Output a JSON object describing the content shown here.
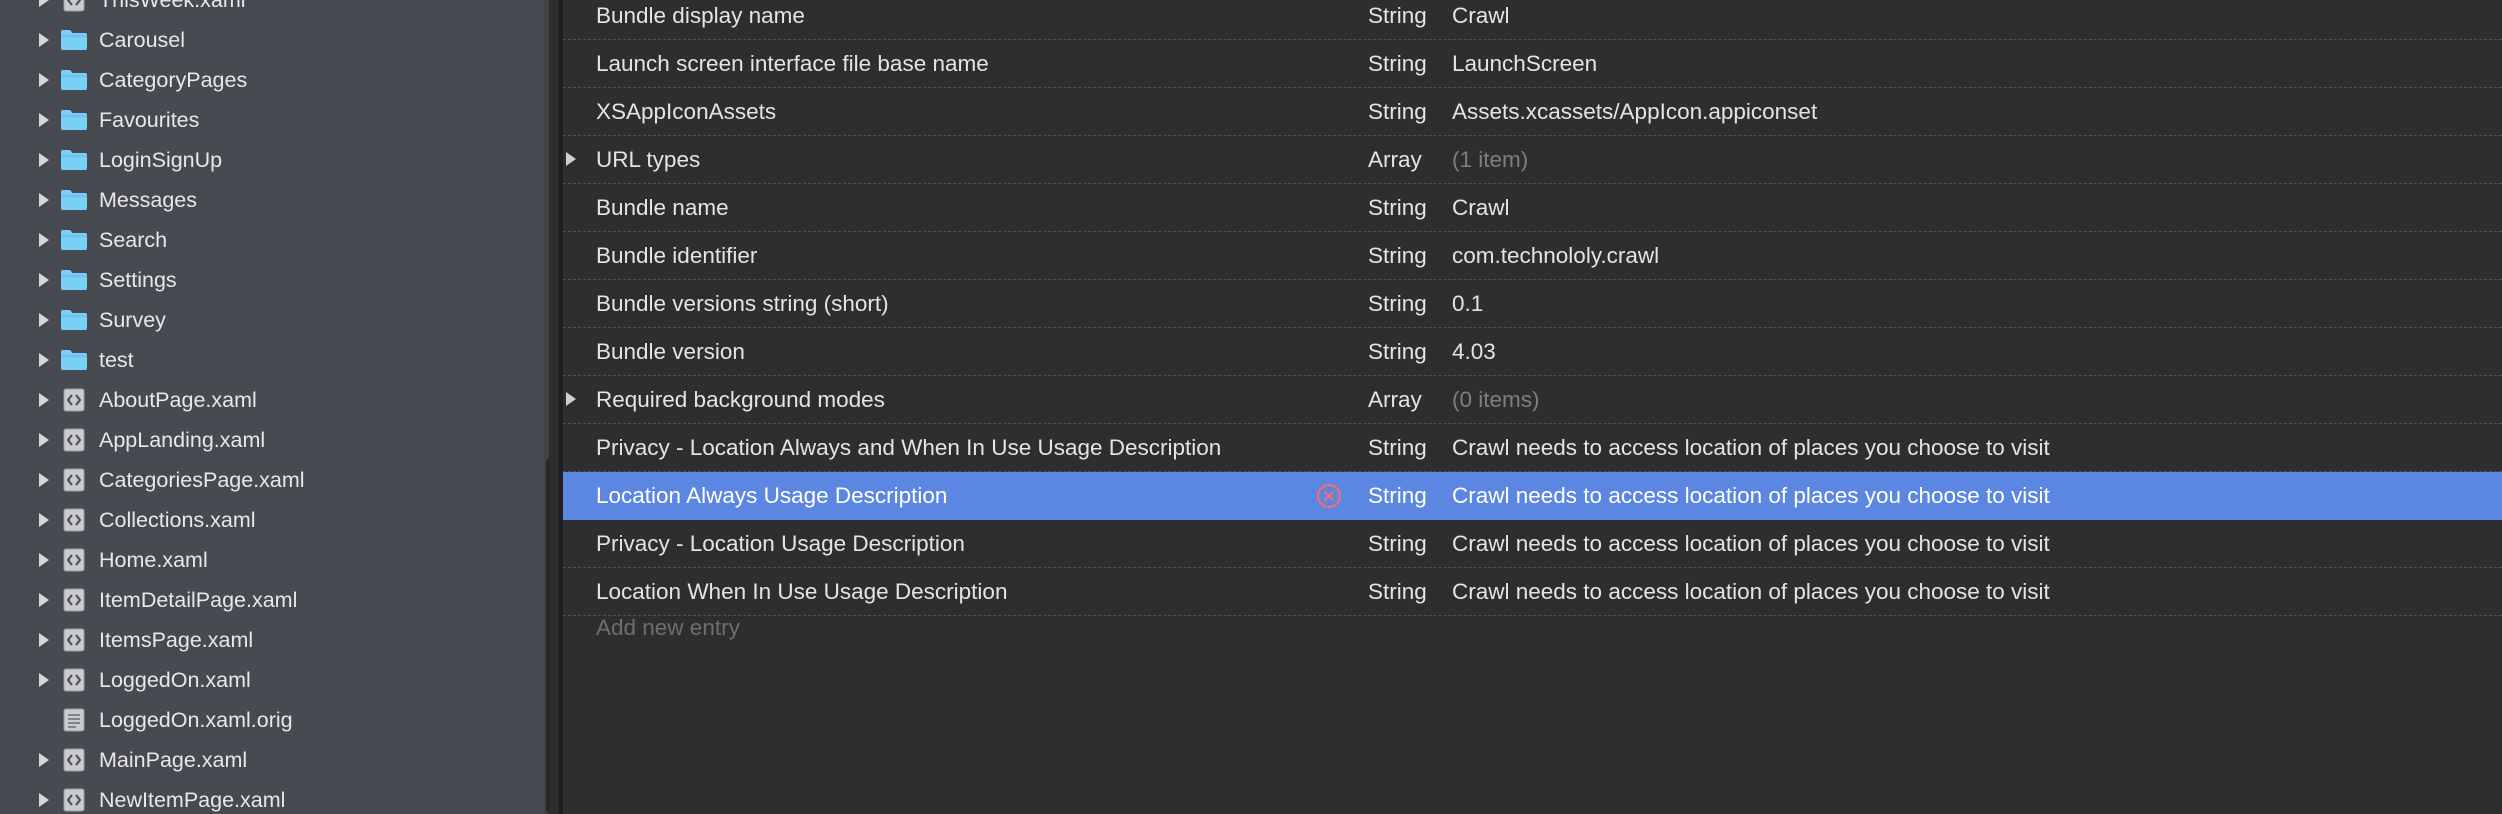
{
  "sidebar": {
    "items": [
      {
        "label": "ThisWeek.xaml",
        "kind": "xaml",
        "icon": "xaml-file-icon",
        "expandable": true
      },
      {
        "label": "Carousel",
        "kind": "folder",
        "icon": "folder-icon",
        "expandable": true
      },
      {
        "label": "CategoryPages",
        "kind": "folder",
        "icon": "folder-icon",
        "expandable": true
      },
      {
        "label": "Favourites",
        "kind": "folder",
        "icon": "folder-icon",
        "expandable": true
      },
      {
        "label": "LoginSignUp",
        "kind": "folder",
        "icon": "folder-icon",
        "expandable": true
      },
      {
        "label": "Messages",
        "kind": "folder",
        "icon": "folder-icon",
        "expandable": true
      },
      {
        "label": "Search",
        "kind": "folder",
        "icon": "folder-icon",
        "expandable": true
      },
      {
        "label": "Settings",
        "kind": "folder",
        "icon": "folder-icon",
        "expandable": true
      },
      {
        "label": "Survey",
        "kind": "folder",
        "icon": "folder-icon",
        "expandable": true
      },
      {
        "label": "test",
        "kind": "folder",
        "icon": "folder-icon",
        "expandable": true
      },
      {
        "label": "AboutPage.xaml",
        "kind": "xaml",
        "icon": "xaml-file-icon",
        "expandable": true
      },
      {
        "label": "AppLanding.xaml",
        "kind": "xaml",
        "icon": "xaml-file-icon",
        "expandable": true
      },
      {
        "label": "CategoriesPage.xaml",
        "kind": "xaml",
        "icon": "xaml-file-icon",
        "expandable": true
      },
      {
        "label": "Collections.xaml",
        "kind": "xaml",
        "icon": "xaml-file-icon",
        "expandable": true
      },
      {
        "label": "Home.xaml",
        "kind": "xaml",
        "icon": "xaml-file-icon",
        "expandable": true
      },
      {
        "label": "ItemDetailPage.xaml",
        "kind": "xaml",
        "icon": "xaml-file-icon",
        "expandable": true
      },
      {
        "label": "ItemsPage.xaml",
        "kind": "xaml",
        "icon": "xaml-file-icon",
        "expandable": true
      },
      {
        "label": "LoggedOn.xaml",
        "kind": "xaml",
        "icon": "xaml-file-icon",
        "expandable": true
      },
      {
        "label": "LoggedOn.xaml.orig",
        "kind": "file",
        "icon": "text-file-icon",
        "expandable": false
      },
      {
        "label": "MainPage.xaml",
        "kind": "xaml",
        "icon": "xaml-file-icon",
        "expandable": true
      },
      {
        "label": "NewItemPage.xaml",
        "kind": "xaml",
        "icon": "xaml-file-icon",
        "expandable": true
      }
    ]
  },
  "plist": {
    "rows": [
      {
        "key": "Bundle display name",
        "type": "String",
        "value": "Crawl",
        "expandable": false,
        "dim": false,
        "selected": false
      },
      {
        "key": "Launch screen interface file base name",
        "type": "String",
        "value": "LaunchScreen",
        "expandable": false,
        "dim": false,
        "selected": false
      },
      {
        "key": "XSAppIconAssets",
        "type": "String",
        "value": "Assets.xcassets/AppIcon.appiconset",
        "expandable": false,
        "dim": false,
        "selected": false
      },
      {
        "key": "URL types",
        "type": "Array",
        "value": "(1 item)",
        "expandable": true,
        "dim": true,
        "selected": false
      },
      {
        "key": "Bundle name",
        "type": "String",
        "value": "Crawl",
        "expandable": false,
        "dim": false,
        "selected": false
      },
      {
        "key": "Bundle identifier",
        "type": "String",
        "value": "com.technololy.crawl",
        "expandable": false,
        "dim": false,
        "selected": false
      },
      {
        "key": "Bundle versions string (short)",
        "type": "String",
        "value": "0.1",
        "expandable": false,
        "dim": false,
        "selected": false
      },
      {
        "key": "Bundle version",
        "type": "String",
        "value": "4.03",
        "expandable": false,
        "dim": false,
        "selected": false
      },
      {
        "key": "Required background modes",
        "type": "Array",
        "value": "(0 items)",
        "expandable": true,
        "dim": true,
        "selected": false
      },
      {
        "key": "Privacy - Location Always and When In Use Usage Description",
        "type": "String",
        "value": "Crawl needs to access location of places you choose to visit",
        "expandable": false,
        "dim": false,
        "selected": false
      },
      {
        "key": "Location Always Usage Description",
        "type": "String",
        "value": "Crawl needs to access location of places you choose to visit",
        "expandable": false,
        "dim": false,
        "selected": true
      },
      {
        "key": "Privacy - Location Usage Description",
        "type": "String",
        "value": "Crawl needs to access location of places you choose to visit",
        "expandable": false,
        "dim": false,
        "selected": false
      },
      {
        "key": "Location When In Use Usage Description",
        "type": "String",
        "value": "Crawl needs to access location of places you choose to visit",
        "expandable": false,
        "dim": false,
        "selected": false
      }
    ],
    "add_entry_placeholder": "Add new entry",
    "remove_icon": "remove-entry-icon"
  },
  "colors": {
    "sidebar_bg": "#474a51",
    "editor_bg": "#2e2e2e",
    "selection": "#5b86e2",
    "folder": "#79d0f5",
    "remove_icon": "#ff6b6b"
  }
}
